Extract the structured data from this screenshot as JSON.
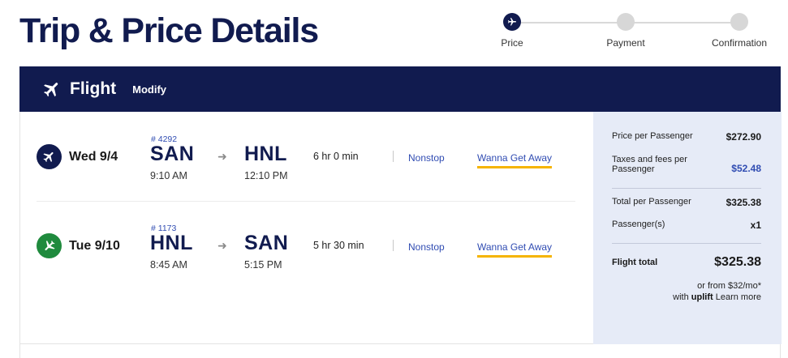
{
  "page": {
    "title": "Trip & Price Details"
  },
  "stepper": {
    "steps": [
      {
        "label": "Price",
        "active": true
      },
      {
        "label": "Payment",
        "active": false
      },
      {
        "label": "Confirmation",
        "active": false
      }
    ]
  },
  "flight_bar": {
    "title": "Flight",
    "modify_label": "Modify",
    "icon": "airplane-icon"
  },
  "segments": [
    {
      "icon": "departing-plane-icon",
      "icon_color": "#111b4f",
      "date": "Wed 9/4",
      "flight_number": "# 4292",
      "from_code": "SAN",
      "from_time": "9:10 AM",
      "to_code": "HNL",
      "to_time": "12:10 PM",
      "duration": "6 hr 0 min",
      "stops": "Nonstop",
      "fare": "Wanna Get Away"
    },
    {
      "icon": "returning-plane-icon",
      "icon_color": "#1f8a3d",
      "date": "Tue 9/10",
      "flight_number": "# 1173",
      "from_code": "HNL",
      "from_time": "8:45 AM",
      "to_code": "SAN",
      "to_time": "5:15 PM",
      "duration": "5 hr 30 min",
      "stops": "Nonstop",
      "fare": "Wanna Get Away"
    }
  ],
  "price": {
    "per_passenger_label": "Price per Passenger",
    "per_passenger_value": "$272.90",
    "taxes_label": "Taxes and fees per Passenger",
    "taxes_value": "$52.48",
    "total_per_passenger_label": "Total per Passenger",
    "total_per_passenger_value": "$325.38",
    "passengers_label": "Passenger(s)",
    "passengers_value": "x1",
    "flight_total_label": "Flight total",
    "flight_total_value": "$325.38",
    "financing_line": "or from $32/mo*",
    "financing_with": "with",
    "financing_brand": "uplift",
    "learn_more": "Learn more"
  },
  "colors": {
    "navy": "#111b4f",
    "link_blue": "#304cb2",
    "gold": "#f5b400",
    "panel_bg": "#e6ebf7",
    "green": "#1f8a3d"
  }
}
